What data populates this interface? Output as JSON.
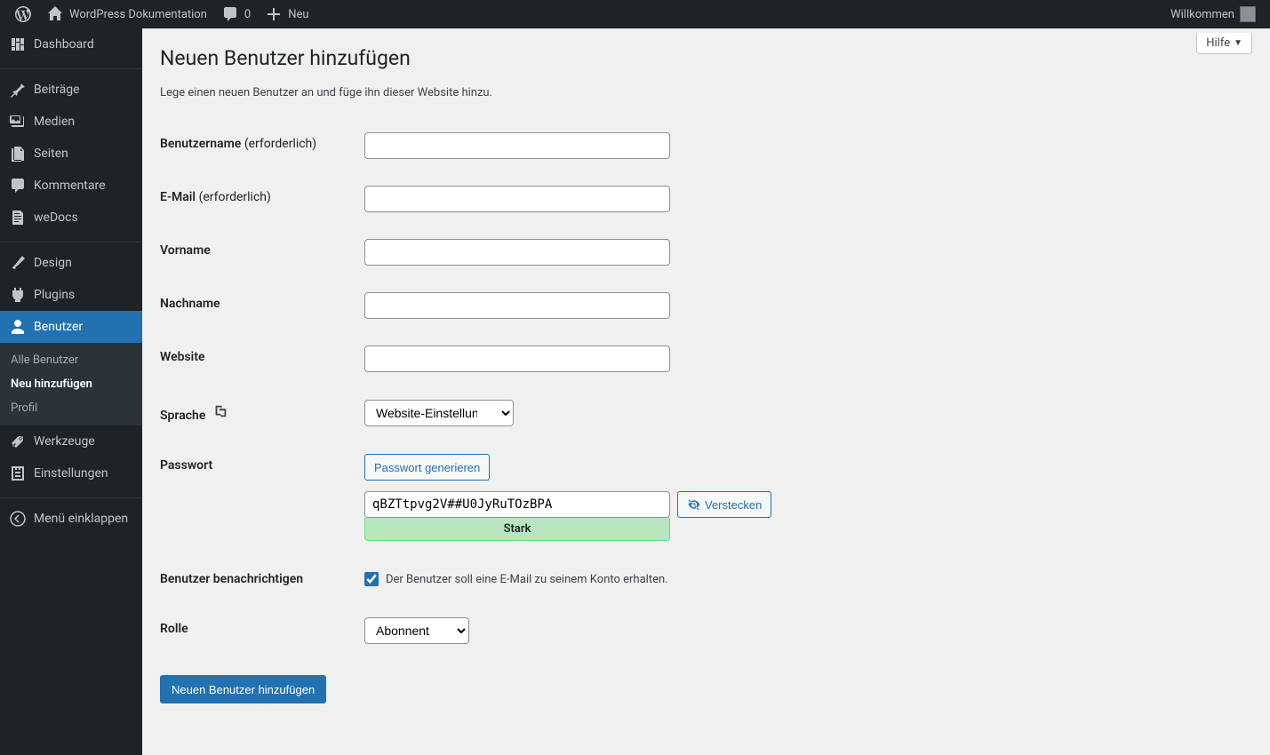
{
  "adminbar": {
    "site_title": "WordPress Dokumentation",
    "comments_count": "0",
    "new_label": "Neu",
    "welcome": "Willkommen"
  },
  "sidebar": {
    "items": [
      {
        "label": "Dashboard",
        "icon": "dashboard"
      },
      {
        "label": "Beiträge",
        "icon": "pin"
      },
      {
        "label": "Medien",
        "icon": "media"
      },
      {
        "label": "Seiten",
        "icon": "page"
      },
      {
        "label": "Kommentare",
        "icon": "comment"
      },
      {
        "label": "weDocs",
        "icon": "doc"
      },
      {
        "label": "Design",
        "icon": "brush"
      },
      {
        "label": "Plugins",
        "icon": "plug"
      },
      {
        "label": "Benutzer",
        "icon": "user"
      },
      {
        "label": "Werkzeuge",
        "icon": "tools"
      },
      {
        "label": "Einstellungen",
        "icon": "settings"
      },
      {
        "label": "Menü einklappen",
        "icon": "collapse"
      }
    ],
    "submenu": {
      "items": [
        {
          "label": "Alle Benutzer"
        },
        {
          "label": "Neu hinzufügen"
        },
        {
          "label": "Profil"
        }
      ]
    }
  },
  "help_tab": "Hilfe",
  "page": {
    "title": "Neuen Benutzer hinzufügen",
    "desc": "Lege einen neuen Benutzer an und füge ihn dieser Website hinzu."
  },
  "form": {
    "username_label": "Benutzername",
    "email_label": "E-Mail",
    "required_suffix": "(erforderlich)",
    "firstname_label": "Vorname",
    "lastname_label": "Nachname",
    "website_label": "Website",
    "language_label": "Sprache",
    "language_value": "Website-Einstellung",
    "password_label": "Passwort",
    "generate_btn": "Passwort generieren",
    "password_value": "qBZTtpvg2V##U0JyRuTOzBPA",
    "hide_btn": "Verstecken",
    "strength": "Stark",
    "notify_label": "Benutzer benachrichtigen",
    "notify_text": "Der Benutzer soll eine E-Mail zu seinem Konto erhalten.",
    "role_label": "Rolle",
    "role_value": "Abonnent",
    "submit": "Neuen Benutzer hinzufügen"
  }
}
